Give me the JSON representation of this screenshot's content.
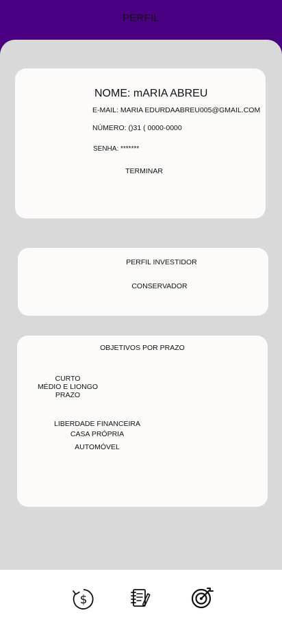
{
  "header": {
    "title": "PERFIL"
  },
  "user": {
    "name": "NOME: mARIA ABREU",
    "email": "E-MAIL: MARIA EDURDAABREU005@GMAIL.COM",
    "phone": "NÚMERO: ()31 ( 0000-0000",
    "password": "SENHA: *******",
    "finish_label": "TERMINAR"
  },
  "investor_profile": {
    "title": "PERFIL INVESTIDOR",
    "value": "CONSERVADOR"
  },
  "goals": {
    "title": "OBJETIVOS POR PRAZO",
    "terms": [
      "CURTO",
      "MÉDIO E LIONGO",
      "PRAZO"
    ],
    "items": [
      "LIBERDADE FINANCEIRA",
      "CASA PRÓPRIA",
      "AUTOMÓVEL"
    ]
  },
  "bottom_nav": {
    "items": [
      {
        "icon": "money-history-icon"
      },
      {
        "icon": "report-icon"
      },
      {
        "icon": "target-icon"
      }
    ]
  },
  "colors": {
    "header": "#4b0082",
    "content_background": "#d9d9d9",
    "card_background": "#fcfbf9"
  }
}
